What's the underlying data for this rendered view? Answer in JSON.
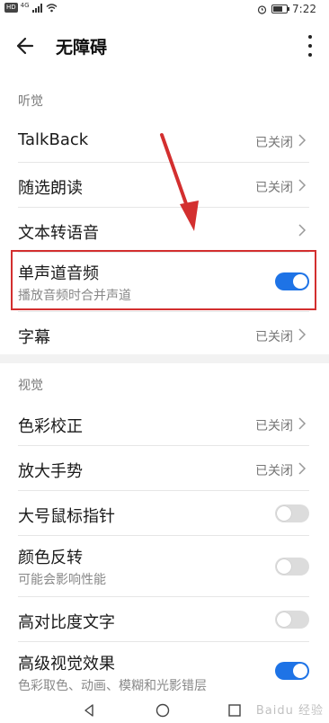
{
  "status_bar": {
    "hd": "HD",
    "network": "4G",
    "time": "7:22",
    "battery_level": 0.8
  },
  "header": {
    "title": "无障碍"
  },
  "sections": {
    "hearing": {
      "title": "听觉",
      "items": [
        {
          "label": "TalkBack",
          "value": "已关闭"
        },
        {
          "label": "随选朗读",
          "value": "已关闭"
        },
        {
          "label": "文本转语音"
        },
        {
          "label": "单声道音频",
          "subtitle": "播放音频时合并声道",
          "toggle": true
        },
        {
          "label": "字幕",
          "value": "已关闭"
        }
      ]
    },
    "vision": {
      "title": "视觉",
      "items": [
        {
          "label": "色彩校正",
          "value": "已关闭"
        },
        {
          "label": "放大手势",
          "value": "已关闭"
        },
        {
          "label": "大号鼠标指针",
          "toggle": false
        },
        {
          "label": "颜色反转",
          "subtitle": "可能会影响性能",
          "toggle": false
        },
        {
          "label": "高对比度文字",
          "toggle": false
        },
        {
          "label": "高级视觉效果",
          "subtitle": "色彩取色、动画、模糊和光影错层",
          "toggle": true
        }
      ]
    }
  },
  "colors": {
    "accent": "#1e73e6",
    "annotation": "#d32f2f"
  },
  "watermark": "Baidu 经验",
  "icons": {
    "back": "back-arrow-icon",
    "more": "more-vertical-icon",
    "chevron": "chevron-right-icon",
    "nav_back": "nav-back-icon",
    "nav_home": "nav-home-icon",
    "nav_recent": "nav-recent-icon"
  }
}
